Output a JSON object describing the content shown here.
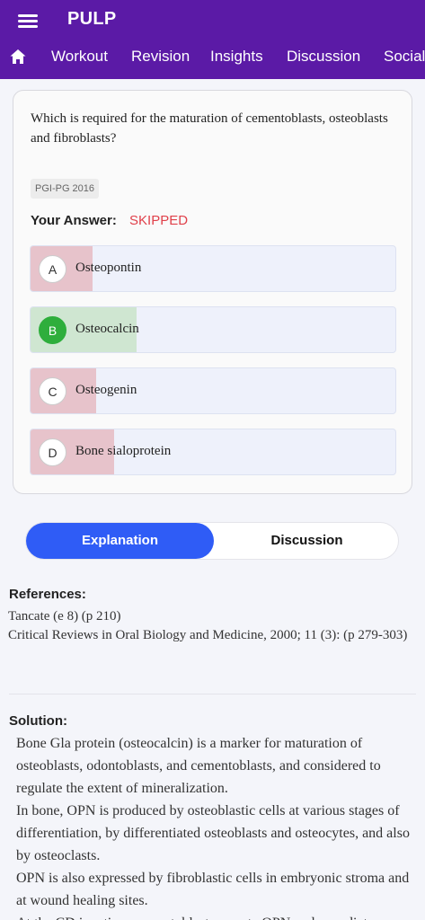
{
  "app": {
    "title": "PULP"
  },
  "nav": {
    "tabs": [
      "Workout",
      "Revision",
      "Insights",
      "Discussion",
      "Social"
    ]
  },
  "question": {
    "text": "Which is required for the maturation of cementoblasts, osteoblasts and fibroblasts?",
    "tag": "PGI-PG 2016",
    "answer_label": "Your Answer:",
    "answer_value": "SKIPPED",
    "options": [
      {
        "letter": "A",
        "text": "Osteopontin",
        "percent": 17,
        "correct": false
      },
      {
        "letter": "B",
        "text": "Osteocalcin",
        "percent": 29,
        "correct": true
      },
      {
        "letter": "C",
        "text": "Osteogenin",
        "percent": 18,
        "correct": false
      },
      {
        "letter": "D",
        "text": "Bone sialoprotein",
        "percent": 23,
        "correct": false
      }
    ]
  },
  "switcher": {
    "explanation": "Explanation",
    "discussion": "Discussion"
  },
  "references": {
    "title": "References:",
    "line1": "Tancate (e 8) (p 210)",
    "line2": "Critical Reviews in Oral Biology and Medicine, 2000; 11 (3): (p 279-303)"
  },
  "solution": {
    "title": "Solution:",
    "p1": "Bone Gla protein (osteocalcin) is a marker for maturation of osteoblasts, odontoblasts, and cementoblasts, and considered to regulate the extent of mineralization.",
    "p2": "In bone, OPN is produced by osteoblastic cells at various stages of differentiation, by differentiated osteoblasts and osteocytes, and also by osteoclasts.",
    "p3": "OPN is also expressed by fibroblastic cells in embryonic stroma and at wound healing sites.",
    "p4": "At the CD junction, cementoblasts secrete OPN and a mediator"
  },
  "colors": {
    "brand": "#5b1aa6",
    "accent": "#2f5cf6",
    "wrong": "#e7c3cb",
    "right": "#cfe6d1",
    "skipped": "#e0404a"
  }
}
